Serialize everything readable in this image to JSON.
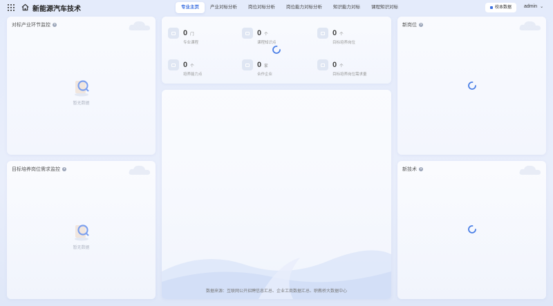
{
  "header": {
    "title": "新能源汽车技术",
    "tabs": [
      {
        "label": "专业主页",
        "active": true
      },
      {
        "label": "产业对标分析",
        "active": false
      },
      {
        "label": "岗位对标分析",
        "active": false
      },
      {
        "label": "岗位能力对标分析",
        "active": false
      },
      {
        "label": "知识能力对标",
        "active": false
      },
      {
        "label": "课程知识对标",
        "active": false
      }
    ],
    "school_button": "校本数据",
    "user": "admin"
  },
  "panels": {
    "industry": {
      "title": "对标产业环节监控",
      "empty_text": "暂无数据"
    },
    "demand": {
      "title": "目标培养岗位需求监控",
      "empty_text": "暂无数据"
    },
    "new_jobs": {
      "title": "新岗位"
    },
    "new_tech": {
      "title": "新技术"
    }
  },
  "stats": [
    {
      "value": "0",
      "unit": "门",
      "label": "专业课程",
      "icon": "book-icon"
    },
    {
      "value": "0",
      "unit": "个",
      "label": "课程知识点",
      "icon": "knowledge-icon"
    },
    {
      "value": "0",
      "unit": "个",
      "label": "目标培养岗位",
      "icon": "job-icon"
    },
    {
      "value": "0",
      "unit": "个",
      "label": "培养能力点",
      "icon": "ability-icon"
    },
    {
      "value": "0",
      "unit": "家",
      "label": "合作企业",
      "icon": "company-icon"
    },
    {
      "value": "0",
      "unit": "个",
      "label": "目标培养岗位需求量",
      "icon": "demand-icon"
    }
  ],
  "footer": {
    "source": "数据来源：互联网公开招聘信息汇总、企业工商数据汇总、职教桥大数据中心"
  },
  "colors": {
    "accent": "#3b6fe0",
    "spinner": "#4a7fe6"
  }
}
